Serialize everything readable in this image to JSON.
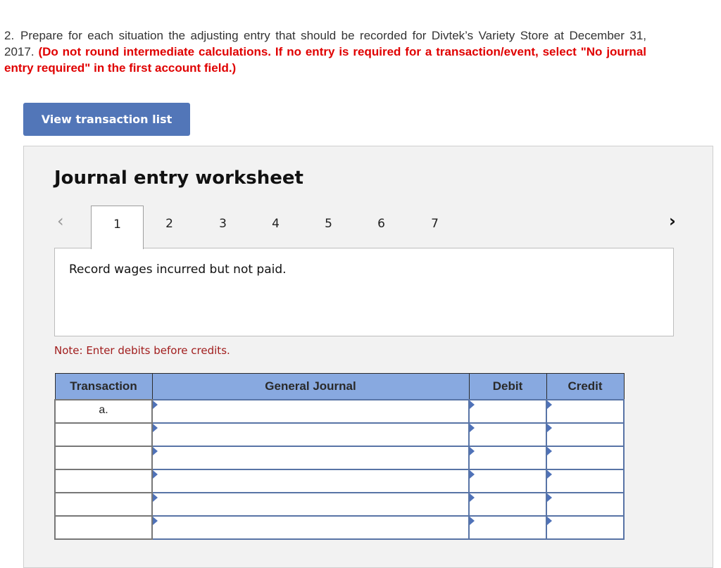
{
  "question": {
    "number": "2.",
    "text": "Prepare for each situation the adjusting entry that should be recorded for Divtek’s Variety Store at December 31, 2017.",
    "instructions": "(Do not round intermediate calculations. If no entry is required for a transaction/event, select \"No journal entry required\" in the first account field.)"
  },
  "view_transaction_button": "View transaction list",
  "worksheet": {
    "title": "Journal entry worksheet",
    "prev_icon": "‹",
    "next_icon": "›",
    "tabs": [
      {
        "label": "1",
        "active": true
      },
      {
        "label": "2",
        "active": false
      },
      {
        "label": "3",
        "active": false
      },
      {
        "label": "4",
        "active": false
      },
      {
        "label": "5",
        "active": false
      },
      {
        "label": "6",
        "active": false
      },
      {
        "label": "7",
        "active": false
      }
    ],
    "description": "Record wages incurred but not paid.",
    "note": "Note: Enter debits before credits.",
    "table": {
      "headers": [
        "Transaction",
        "General Journal",
        "Debit",
        "Credit"
      ],
      "rows": [
        {
          "transaction": "a.",
          "account": "",
          "debit": "",
          "credit": ""
        },
        {
          "transaction": "",
          "account": "",
          "debit": "",
          "credit": ""
        },
        {
          "transaction": "",
          "account": "",
          "debit": "",
          "credit": ""
        },
        {
          "transaction": "",
          "account": "",
          "debit": "",
          "credit": ""
        },
        {
          "transaction": "",
          "account": "",
          "debit": "",
          "credit": ""
        },
        {
          "transaction": "",
          "account": "",
          "debit": "",
          "credit": ""
        }
      ]
    }
  }
}
